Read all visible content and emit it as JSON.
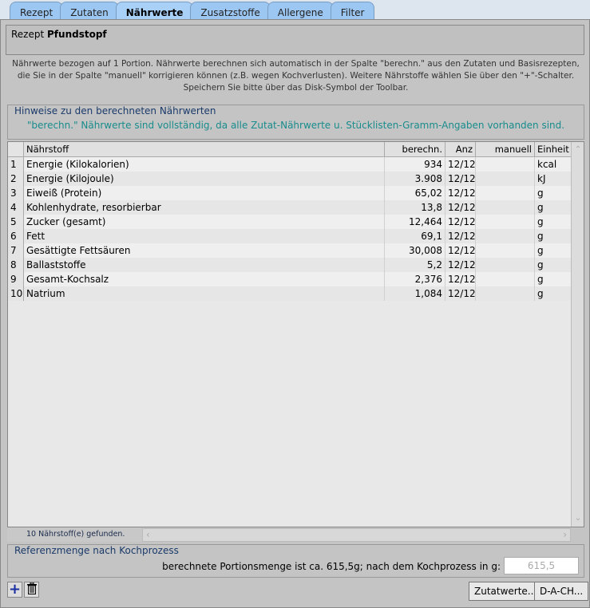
{
  "tabs": [
    "Rezept",
    "Zutaten",
    "Nährwerte",
    "Zusatzstoffe",
    "Allergene",
    "Filter"
  ],
  "active_tab": "Nährwerte",
  "recipe": {
    "label": "Rezept",
    "name": "Pfundstopf"
  },
  "info": "Nährwerte bezogen auf 1 Portion. Nährwerte berechnen sich automatisch in der Spalte \"berechn.\" aus den Zutaten und Basisrezepten, die Sie in der Spalte \"manuell\" korrigieren können (z.B. wegen Kochverlusten). Weitere Nährstoffe wählen Sie über den \"+\"-Schalter. Speichern Sie bitte über das Disk-Symbol der Toolbar.",
  "hint": {
    "title": "Hinweise zu den berechneten Nährwerten",
    "message": "\"berechn.\" Nährwerte sind vollständig, da alle Zutat-Nährwerte u. Stücklisten-Gramm-Angaben vorhanden sind."
  },
  "table": {
    "columns": [
      "",
      "Nährstoff",
      "berechn.",
      "Anz",
      "manuell",
      "Einheit"
    ],
    "rows": [
      [
        "1",
        "Energie (Kilokalorien)",
        "934",
        "12/12",
        "",
        "kcal"
      ],
      [
        "2",
        "Energie (Kilojoule)",
        "3.908",
        "12/12",
        "",
        "kJ"
      ],
      [
        "3",
        "Eiweiß (Protein)",
        "65,02",
        "12/12",
        "",
        "g"
      ],
      [
        "4",
        "Kohlenhydrate, resorbierbar",
        "13,8",
        "12/12",
        "",
        "g"
      ],
      [
        "5",
        "Zucker (gesamt)",
        "12,464",
        "12/12",
        "",
        "g"
      ],
      [
        "6",
        "Fett",
        "69,1",
        "12/12",
        "",
        "g"
      ],
      [
        "7",
        "Gesättigte Fettsäuren",
        "30,008",
        "12/12",
        "",
        "g"
      ],
      [
        "8",
        "Ballaststoffe",
        "5,2",
        "12/12",
        "",
        "g"
      ],
      [
        "9",
        "Gesamt-Kochsalz",
        "2,376",
        "12/12",
        "",
        "g"
      ],
      [
        "10",
        "Natrium",
        "1,084",
        "12/12",
        "",
        "g"
      ]
    ]
  },
  "status": "10  Nährstoff(e) gefunden.",
  "reference": {
    "title": "Referenzmenge nach Kochprozess",
    "label": "berechnete Portionsmenge ist ca. 615,5g; nach dem Kochprozess in g:",
    "value": "615,5"
  },
  "buttons": {
    "add": "+",
    "zutatwerte": "Zutatwerte...",
    "dach": "D-A-CH..."
  }
}
